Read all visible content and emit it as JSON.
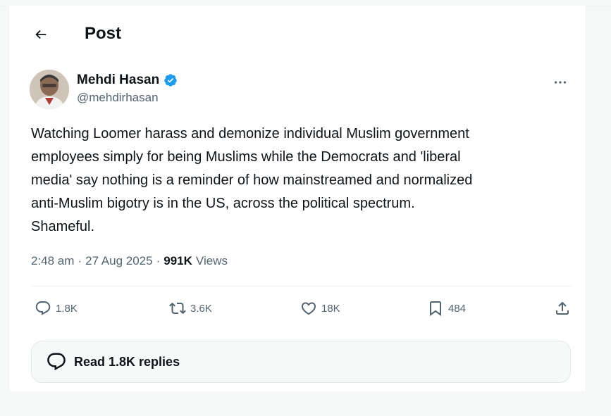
{
  "header": {
    "title": "Post",
    "back_icon": "arrow-left-icon"
  },
  "author": {
    "display_name": "Mehdi Hasan",
    "handle": "@mehdirhasan",
    "verified": true,
    "verified_color": "#1d9bf0"
  },
  "tweet": {
    "lines": [
      "Watching Loomer harass and demonize individual Muslim government",
      "employees simply for being Muslims while the Democrats and 'liberal",
      "media' say nothing is a reminder of how mainstreamed and normalized",
      "anti-Muslim bigotry is in the US, across the political spectrum.",
      "Shameful."
    ]
  },
  "meta": {
    "time": "2:48 am",
    "separator": "·",
    "date": "27 Aug 2025",
    "views_count": "991K",
    "views_label": "Views"
  },
  "actions": {
    "replies": "1.8K",
    "reposts": "3.6K",
    "likes": "18K",
    "bookmarks": "484"
  },
  "replies_button": {
    "label": "Read 1.8K replies"
  },
  "colors": {
    "text_primary": "#0f1419",
    "text_secondary": "#536471",
    "border": "#eff3f4",
    "accent": "#1d9bf0"
  }
}
